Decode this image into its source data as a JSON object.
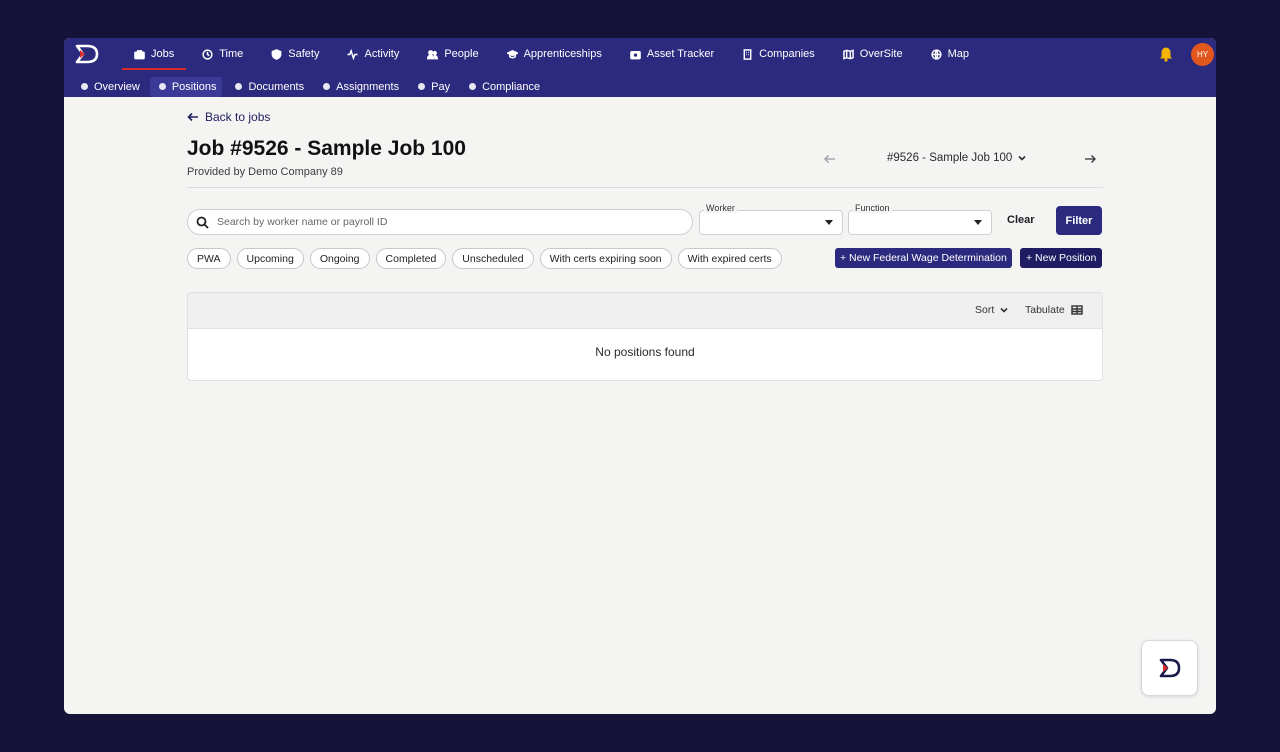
{
  "nav": {
    "items": [
      {
        "label": "Jobs",
        "icon": "briefcase-icon",
        "active": true
      },
      {
        "label": "Time",
        "icon": "clock-icon"
      },
      {
        "label": "Safety",
        "icon": "shield-icon"
      },
      {
        "label": "Activity",
        "icon": "activity-icon"
      },
      {
        "label": "People",
        "icon": "people-icon"
      },
      {
        "label": "Apprenticeships",
        "icon": "graduation-cap-icon"
      },
      {
        "label": "Asset Tracker",
        "icon": "camera-icon"
      },
      {
        "label": "Companies",
        "icon": "building-icon"
      },
      {
        "label": "OverSite",
        "icon": "map-book-icon"
      },
      {
        "label": "Map",
        "icon": "globe-icon"
      }
    ],
    "avatar_initials": "HY"
  },
  "subnav": {
    "items": [
      {
        "label": "Overview"
      },
      {
        "label": "Positions",
        "active": true
      },
      {
        "label": "Documents"
      },
      {
        "label": "Assignments"
      },
      {
        "label": "Pay"
      },
      {
        "label": "Compliance"
      }
    ]
  },
  "header": {
    "back_label": "Back to jobs",
    "title": "Job #9526 - Sample Job 100",
    "subtitle": "Provided by Demo Company 89",
    "job_selector": "#9526 - Sample Job 100"
  },
  "filters": {
    "search_placeholder": "Search by worker name or payroll ID",
    "worker_label": "Worker",
    "function_label": "Function",
    "clear_label": "Clear",
    "filter_label": "Filter"
  },
  "chips": [
    "PWA",
    "Upcoming",
    "Ongoing",
    "Completed",
    "Unscheduled",
    "With certs expiring soon",
    "With expired certs"
  ],
  "actions": {
    "new_wage_label": "+ New Federal Wage Determination",
    "new_position_label": "+ New Position"
  },
  "panel": {
    "sort_label": "Sort",
    "tabulate_label": "Tabulate",
    "empty_message": "No positions found"
  },
  "colors": {
    "nav_bg": "#2c2a7e",
    "active_underline": "#d72b2b",
    "avatar_bg": "#e2571d",
    "bell": "#f5b400"
  }
}
